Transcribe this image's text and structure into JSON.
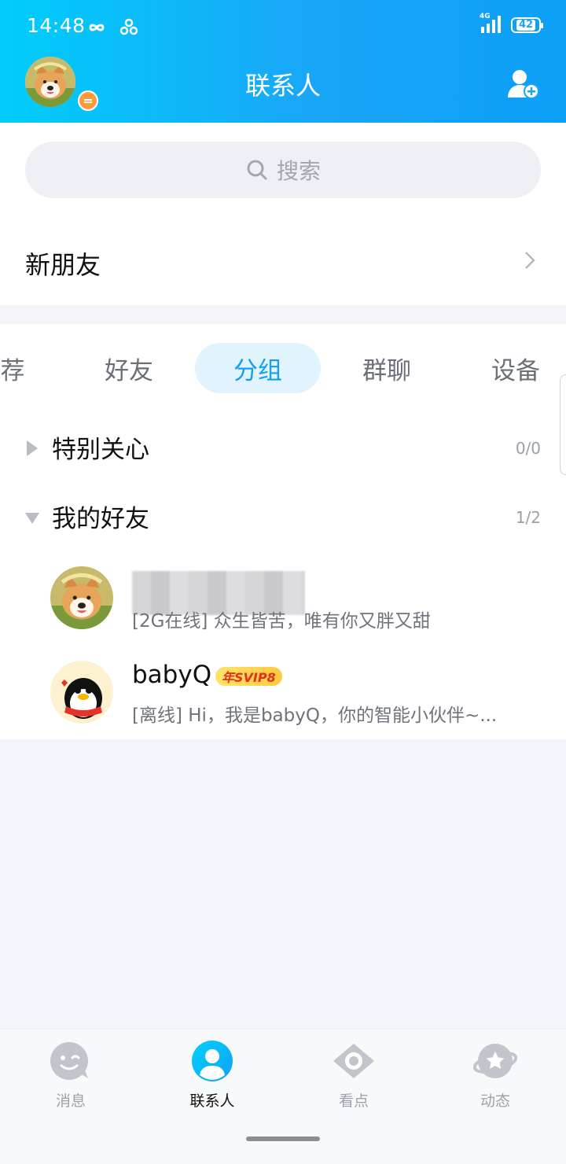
{
  "status_bar": {
    "time": "14:48",
    "network": "4G",
    "battery": "42"
  },
  "header": {
    "title": "联系人"
  },
  "search": {
    "placeholder": "搜索"
  },
  "new_friends": {
    "label": "新朋友"
  },
  "tabs": [
    {
      "label": "荐"
    },
    {
      "label": "好友"
    },
    {
      "label": "分组"
    },
    {
      "label": "群聊"
    },
    {
      "label": "设备"
    }
  ],
  "groups": [
    {
      "name": "特别关心",
      "count": "0/0"
    },
    {
      "name": "我的好友",
      "count": "1/2"
    }
  ],
  "friends": [
    {
      "status": "[2G在线] 众生皆苦，唯有你又胖又甜"
    },
    {
      "name": "babyQ",
      "badge": "年SVIP8",
      "status": "[离线] Hi，我是babyQ，你的智能小伙伴~..."
    }
  ],
  "bottom_nav": [
    {
      "label": "消息"
    },
    {
      "label": "联系人"
    },
    {
      "label": "看点"
    },
    {
      "label": "动态"
    }
  ],
  "colors": {
    "accent": "#12a0f5",
    "header_gradient_start": "#00cdfb",
    "header_gradient_end": "#0b9ff6",
    "status_badge": "#ff9a3c"
  }
}
